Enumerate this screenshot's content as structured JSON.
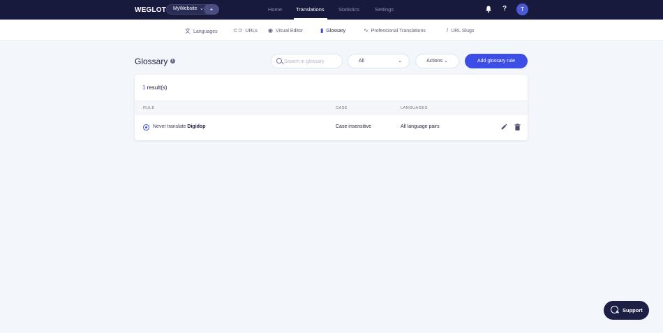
{
  "topbar": {
    "logo": "WEGLOT",
    "site_name": "MyWebsite",
    "site_caret": "⌄",
    "add_label": "+",
    "nav": [
      {
        "label": "Home",
        "active": false
      },
      {
        "label": "Translations",
        "active": true
      },
      {
        "label": "Statistics",
        "active": false
      },
      {
        "label": "Settings",
        "active": false
      }
    ],
    "help_label": "?",
    "avatar_initial": "T"
  },
  "subnav": {
    "items": [
      {
        "label": "Languages",
        "icon": "translate-icon"
      },
      {
        "label": "URLs",
        "icon": "link-icon"
      },
      {
        "label": "Visual Editor",
        "icon": "eye-icon"
      },
      {
        "label": "Glossary",
        "icon": "book-icon",
        "active": true
      },
      {
        "label": "Professional Translations",
        "icon": "pen-icon"
      },
      {
        "label": "URL Slugs",
        "icon": "slash-icon"
      }
    ]
  },
  "page": {
    "title": "Glossary",
    "info": "i",
    "search_placeholder": "Search in glossary",
    "filter_value": "All",
    "filter_caret": "⌄",
    "actions_label": "Actions ⌄",
    "add_button": "Add glossary rule"
  },
  "table": {
    "result_count": "1",
    "result_suffix": " result(s)",
    "headers": {
      "rule": "RULE",
      "case": "CASE",
      "languages": "LANGUAGES"
    },
    "rows": [
      {
        "rule_prefix": "Never translate ",
        "rule_word": "Digidop",
        "case": "Case insensitive",
        "languages": "All language pairs"
      }
    ]
  },
  "support": {
    "label": "Support"
  },
  "colors": {
    "accent": "#3d4ee6",
    "topbar": "#181a3d",
    "background": "#f3f6fb"
  }
}
